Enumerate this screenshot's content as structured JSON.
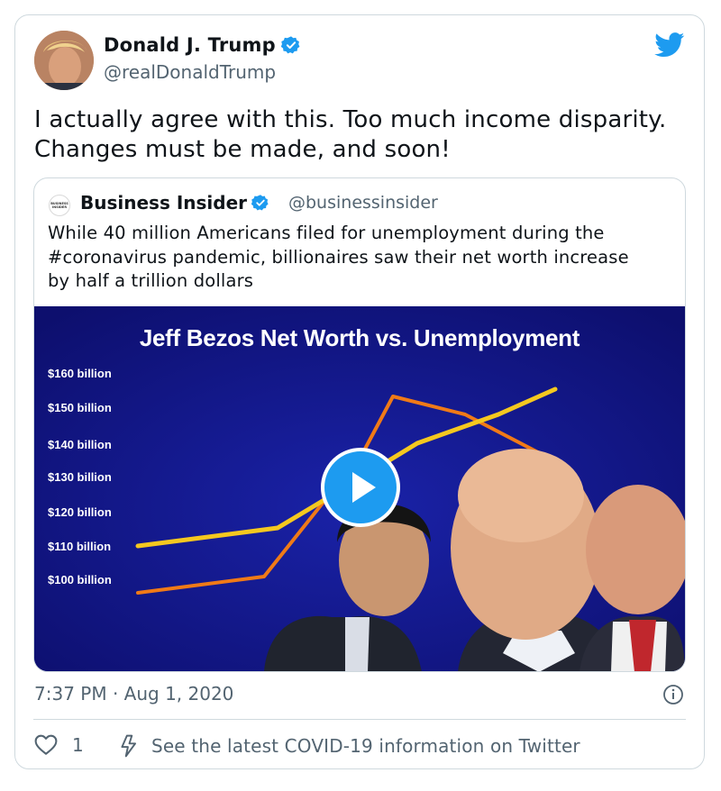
{
  "tweet": {
    "author_name": "Donald J. Trump",
    "author_handle": "@realDonaldTrump",
    "text_lines": [
      "I actually agree with this. Too much income disparity.",
      "Changes must be made, and soon!"
    ],
    "timestamp": "7:37 PM · Aug 1, 2020",
    "like_count": "1",
    "covid_link": "See the latest COVID-19 information on Twitter"
  },
  "quote": {
    "logo_text": [
      "BUSINESS",
      "INSIDER"
    ],
    "author_name": "Business Insider",
    "author_handle": "@businessinsider",
    "text_lines": [
      "While 40 million Americans filed for unemployment during the",
      "#coronavirus pandemic, billionaires saw their net worth increase",
      "by half a trillion dollars"
    ]
  },
  "media": {
    "title": "Jeff Bezos Net Worth vs. Unemployment",
    "y_ticks": [
      "$160 billion",
      "$150 billion",
      "$140 billion",
      "$130 billion",
      "$120 billion",
      "$110 billion",
      "$100 billion"
    ]
  },
  "colors": {
    "twitter_blue": "#1d9bf0",
    "media_background": "#13148a",
    "yellow_line": "#f5c81f",
    "orange_line": "#f07a17",
    "muted_text": "#536471"
  },
  "icons": {
    "verified": "verified-badge-icon",
    "twitter": "twitter-bird-icon",
    "play": "play-icon",
    "info": "info-icon",
    "heart": "heart-icon",
    "bolt": "lightning-icon"
  }
}
